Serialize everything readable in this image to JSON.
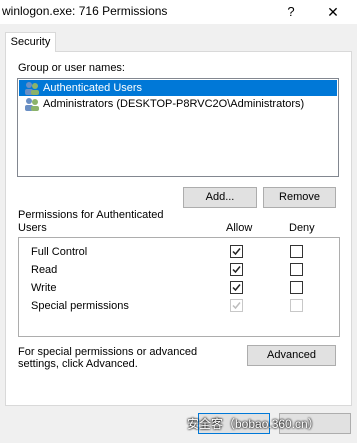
{
  "window": {
    "title": "winlogon.exe: 716 Permissions",
    "help_glyph": "?",
    "close_glyph": "✕"
  },
  "tabs": [
    {
      "label": "Security"
    }
  ],
  "group": {
    "label": "Group or user names:",
    "items": [
      {
        "label": "Authenticated Users",
        "icon": "users-icon",
        "selected": true
      },
      {
        "label": "Administrators (DESKTOP-P8RVC2O\\Administrators)",
        "icon": "users-icon",
        "selected": false
      }
    ]
  },
  "buttons": {
    "add": "Add...",
    "remove": "Remove",
    "advanced": "Advanced"
  },
  "permissions": {
    "label": "Permissions for Authenticated Users",
    "allow_header": "Allow",
    "deny_header": "Deny",
    "rows": [
      {
        "name": "Full Control",
        "allow": true,
        "deny": false,
        "enabled": true
      },
      {
        "name": "Read",
        "allow": true,
        "deny": false,
        "enabled": true
      },
      {
        "name": "Write",
        "allow": true,
        "deny": false,
        "enabled": true
      },
      {
        "name": "Special permissions",
        "allow": true,
        "deny": false,
        "enabled": false
      }
    ]
  },
  "special_note": "For special permissions or advanced settings, click Advanced.",
  "watermark": "安全客（bobao.360.cn）",
  "colors": {
    "selection": "#0078d7",
    "panel": "#ffffff",
    "window_bg": "#f0f0f0"
  }
}
